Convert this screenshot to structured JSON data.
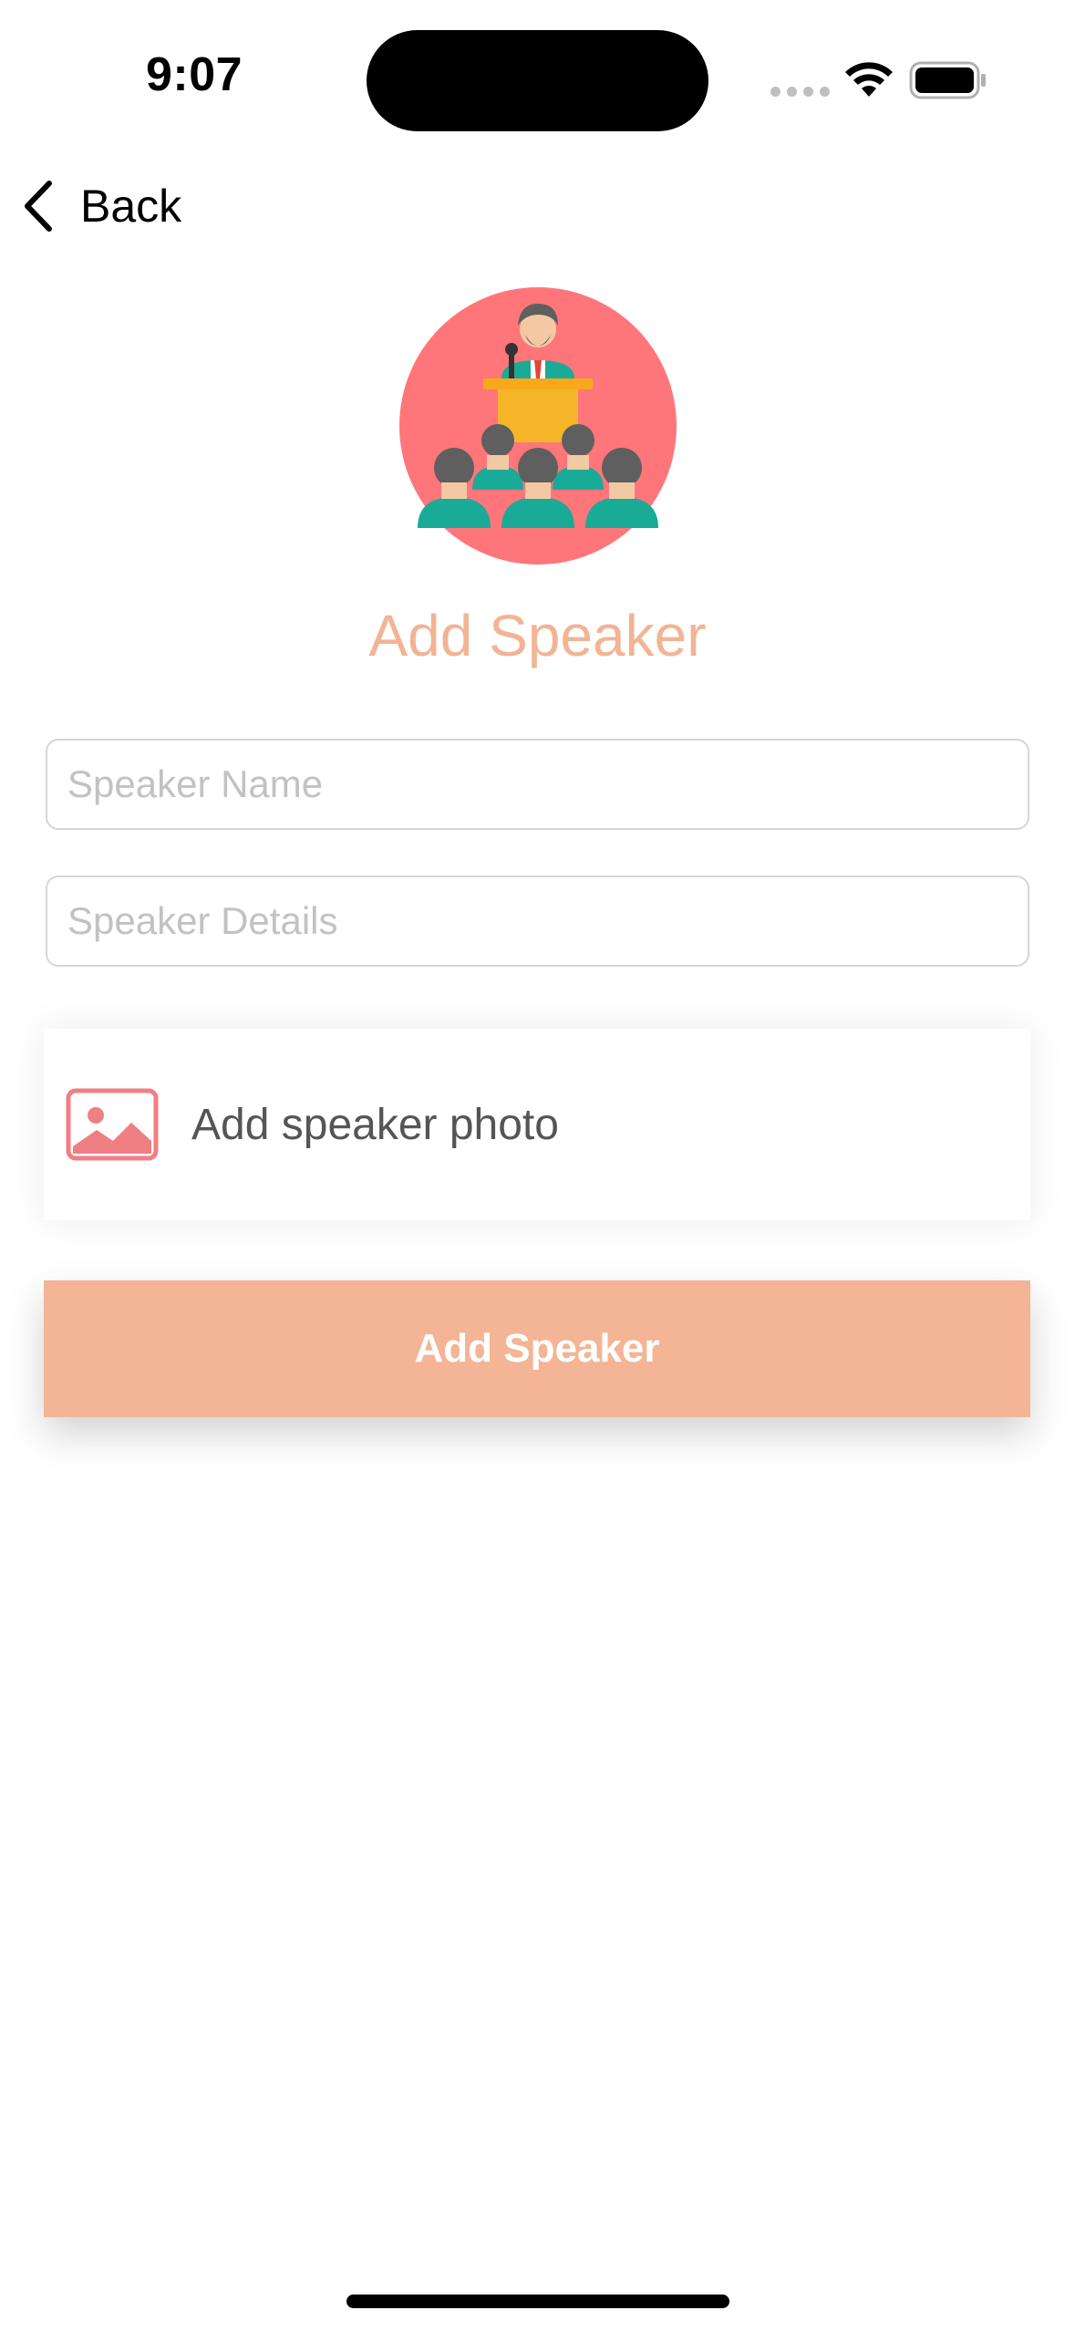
{
  "status_bar": {
    "time": "9:07",
    "icons": [
      "signal-dots-icon",
      "wifi-icon",
      "battery-icon"
    ]
  },
  "nav": {
    "back_label": "Back",
    "back_icon": "chevron-left-icon"
  },
  "hero": {
    "icon": "speaker-podium-audience-icon",
    "circle_color": "#ff767a"
  },
  "title": "Add Speaker",
  "form": {
    "speaker_name": {
      "value": "",
      "placeholder": "Speaker Name"
    },
    "speaker_details": {
      "value": "",
      "placeholder": "Speaker Details"
    },
    "photo": {
      "label": "Add speaker photo",
      "icon": "image-icon"
    },
    "submit_label": "Add Speaker"
  },
  "colors": {
    "accent": "#f3b596",
    "title": "#f2b494",
    "photo_icon": "#f07f83"
  }
}
